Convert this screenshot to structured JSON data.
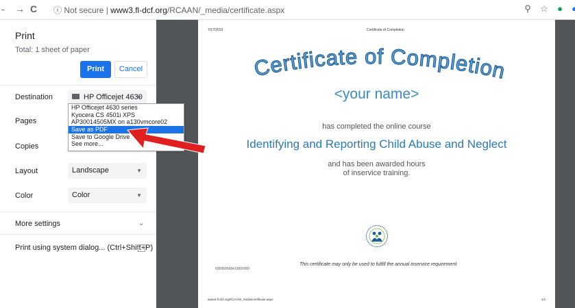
{
  "browser": {
    "nav_partial": "-",
    "back": "→",
    "reload": "C",
    "info_icon": "ⓘ",
    "security_label": "Not secure",
    "separator": "|",
    "url_host": "www3.fl-dcf.org",
    "url_path": "/RCAAN/_media/certificate.aspx"
  },
  "print_panel": {
    "title": "Print",
    "total": "Total: 1 sheet of paper",
    "print_label": "Print",
    "cancel_label": "Cancel",
    "destination": {
      "label": "Destination",
      "value": "HP Officejet 4630",
      "options": [
        "HP Officejet 4630 series",
        "Kyocera CS 4501i XPS",
        "AP30014505MX on a130vmcore02",
        "Save as PDF",
        "Save to Google Drive",
        "See more..."
      ],
      "selected_option": "Save as PDF"
    },
    "pages_label": "Pages",
    "copies_label": "Copies",
    "layout": {
      "label": "Layout",
      "value": "Landscape"
    },
    "color": {
      "label": "Color",
      "value": "Color"
    },
    "more_settings": "More settings",
    "system_dialog": "Print using system dialog... (Ctrl+Shift+P)"
  },
  "certificate": {
    "date": "7/17/2019",
    "header": "Certificate of Completion",
    "title": "Certificate of Completion",
    "name": "<your name>",
    "completed": "has completed the online course",
    "course": "Identifying and Reporting Child Abuse and Neglect",
    "awarded_line1": "and has been awarded hours",
    "awarded_line2": "of inservice training.",
    "note": "This certificate may only be used to fulfill the annual inservice requirement.",
    "cert_id": "636969568410000000",
    "footer_url": "www3.fl-dcf.org/RCAAN/_media/certificate.aspx",
    "page": "1/1"
  },
  "colors": {
    "print_button": "#1a73e8",
    "preview_bg": "#525659",
    "arrow": "#e02020",
    "title_fill": "#6aa8d8",
    "title_stroke": "#1f5f99"
  }
}
